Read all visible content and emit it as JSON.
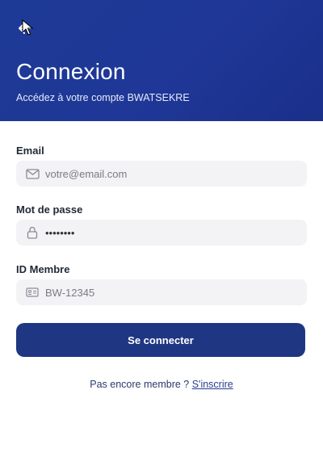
{
  "header": {
    "title": "Connexion",
    "subtitle": "Accédez à votre compte BWATSEKRE",
    "back_icon": "arrow-left-icon",
    "background": "#1f3797"
  },
  "form": {
    "email": {
      "label": "Email",
      "placeholder": "votre@email.com",
      "icon": "mail-icon"
    },
    "password": {
      "label": "Mot de passe",
      "value": "12345678",
      "icon": "lock-icon"
    },
    "member_id": {
      "label": "ID Membre",
      "placeholder": "BW-12345",
      "icon": "id-card-icon"
    },
    "submit_label": "Se connecter",
    "submit_color": "#1f3682"
  },
  "footer": {
    "prompt": "Pas encore membre ? ",
    "signup_link": "S'inscrire"
  }
}
